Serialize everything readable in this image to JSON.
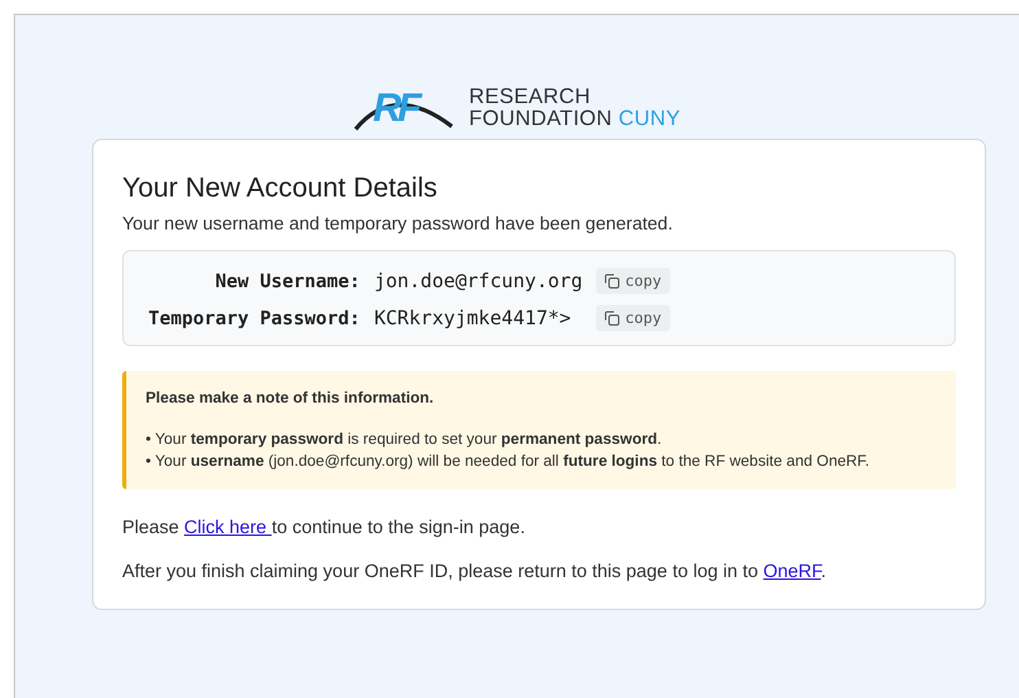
{
  "logo": {
    "mark": "RF",
    "line1": "RESEARCH",
    "line2": "FOUNDATION",
    "line2_accent": "CUNY"
  },
  "card": {
    "title": "Your New Account Details",
    "subtitle": "Your new username and temporary password have been generated.",
    "credentials": [
      {
        "label": "New Username:",
        "value": "jon.doe@rfcuny.org",
        "copy": "copy"
      },
      {
        "label": "Temporary Password:",
        "value": "KCRkrxyjmke4417*>",
        "copy": "copy"
      }
    ],
    "notice": {
      "heading": "Please make a note of this information.",
      "bullets": [
        "• Your **temporary password** is required to set your **permanent password**.",
        "• Your **username** (jon.doe@rfcuny.org) will be needed for all **future logins** to the RF website and OneRF."
      ]
    },
    "links": [
      {
        "before": "Please ",
        "link": "Click here ",
        "after": "to continue to the sign-in page."
      },
      {
        "before": "After you finish claiming your OneRF ID, please return to this page to log in to ",
        "link": "OneRF",
        "after": "."
      }
    ]
  }
}
